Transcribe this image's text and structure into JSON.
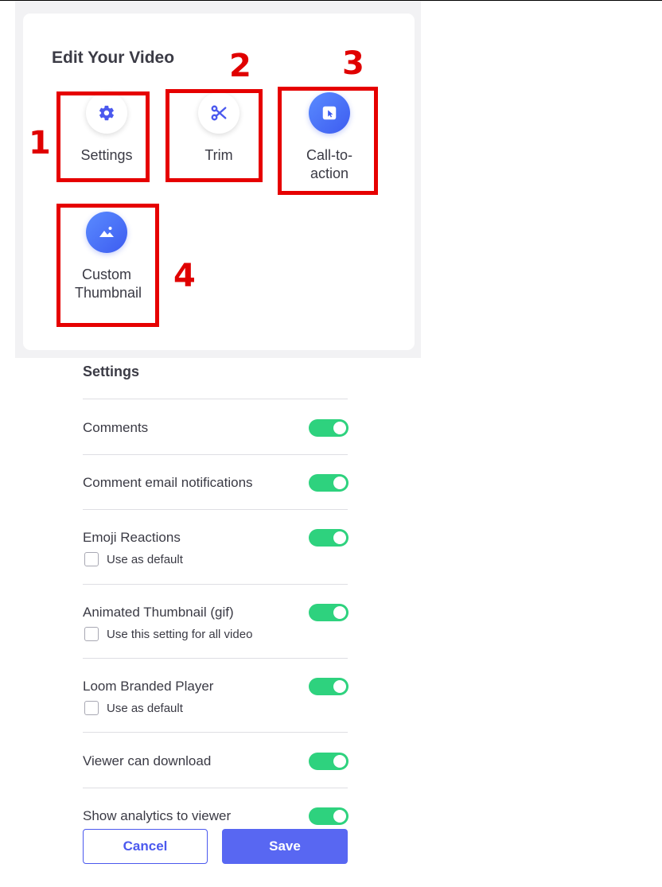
{
  "edit_panel": {
    "title": "Edit Your Video",
    "tools": [
      {
        "label": "Settings",
        "icon": "gear-icon",
        "annotation": "1"
      },
      {
        "label": "Trim",
        "icon": "scissors-icon",
        "annotation": "2"
      },
      {
        "label": "Call-to-action",
        "icon": "cursor-click-icon",
        "annotation": "3"
      },
      {
        "label": "Custom Thumbnail",
        "icon": "image-icon",
        "annotation": "4"
      }
    ]
  },
  "settings": {
    "heading": "Settings",
    "rows": [
      {
        "label": "Comments",
        "enabled": true
      },
      {
        "label": "Comment email notifications",
        "enabled": true
      },
      {
        "label": "Emoji Reactions",
        "enabled": true,
        "checkbox_label": "Use as default",
        "checked": false
      },
      {
        "label": "Animated Thumbnail (gif)",
        "enabled": true,
        "checkbox_label": "Use this setting for all video",
        "checked": false
      },
      {
        "label": "Loom Branded Player",
        "enabled": true,
        "checkbox_label": "Use as default",
        "checked": false
      },
      {
        "label": "Viewer can download",
        "enabled": true
      },
      {
        "label": "Show analytics to viewer",
        "enabled": true
      }
    ]
  },
  "buttons": {
    "cancel": "Cancel",
    "save": "Save"
  },
  "colors": {
    "annotation_red": "#e60000",
    "toggle_on": "#2ed27e",
    "primary": "#5867f2",
    "icon_blue": "#4b59ee"
  }
}
